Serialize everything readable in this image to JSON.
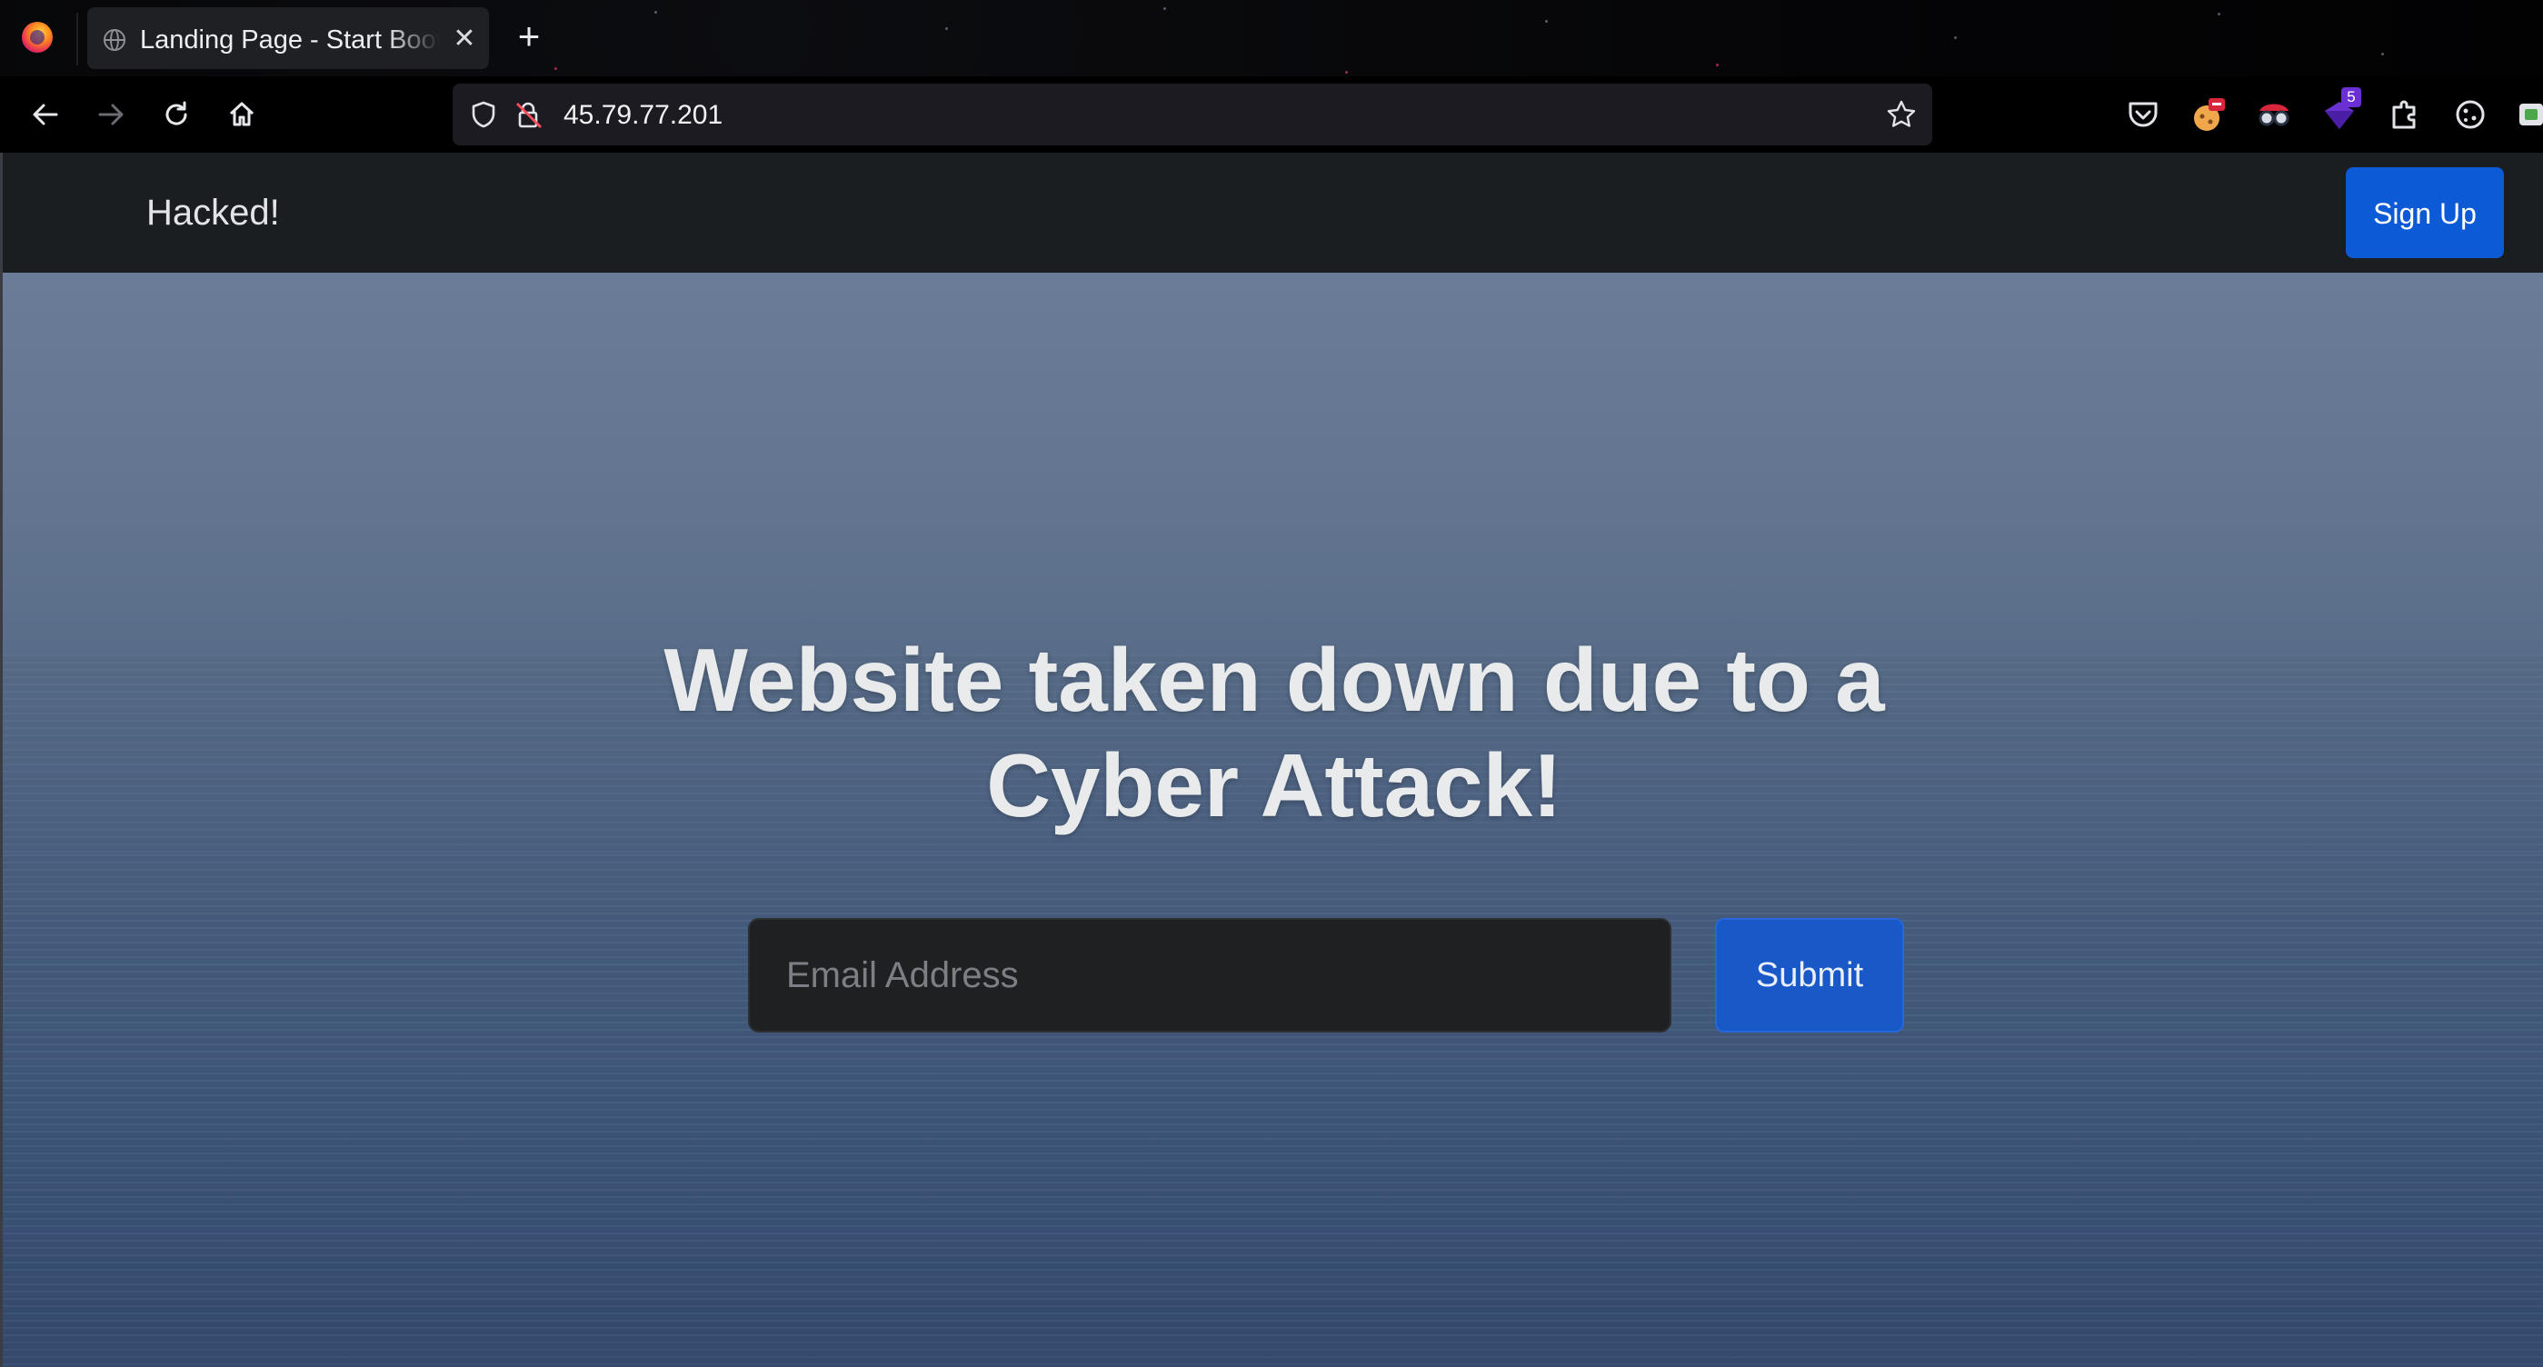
{
  "browser": {
    "tab": {
      "title": "Landing Page - Start Bootstrap Theme",
      "close_glyph": "✕"
    },
    "new_tab_glyph": "+",
    "url": "45.79.77.201",
    "extension_badge": "5"
  },
  "site": {
    "brand": "Hacked!",
    "signup_label": "Sign Up",
    "headline_line1": "Website taken down due to a",
    "headline_line2": "Cyber Attack!",
    "email_placeholder": "Email Address",
    "submit_label": "Submit"
  },
  "colors": {
    "nav_bg": "#1b1e21",
    "primary": "#0d5ad6",
    "hero_top": "#6a7c97",
    "hero_bottom": "#354c70"
  }
}
